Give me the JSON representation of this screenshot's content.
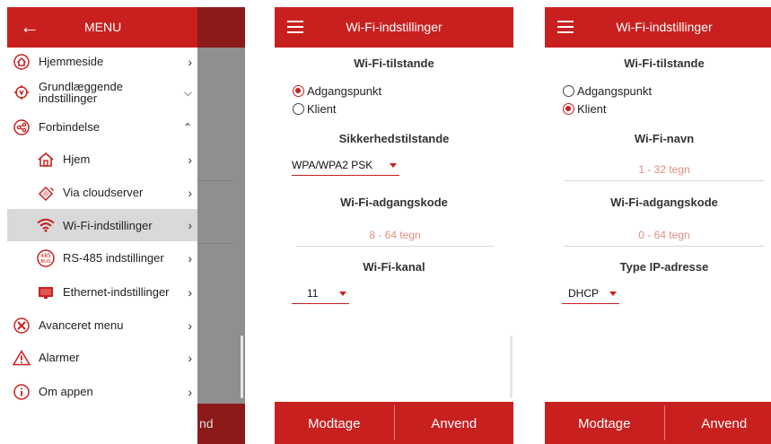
{
  "drawer": {
    "title": "MENU",
    "items": [
      {
        "label": "Hjemmeside"
      },
      {
        "label": "Grundlæggende\nindstillinger"
      },
      {
        "label": "Forbindelse"
      },
      {
        "label": "Hjem"
      },
      {
        "label": "Via cloudserver"
      },
      {
        "label": "Wi-Fi-indstillinger"
      },
      {
        "label": "RS-485 indstillinger"
      },
      {
        "label": "Ethernet-indstillinger"
      },
      {
        "label": "Avanceret menu"
      },
      {
        "label": "Alarmer"
      },
      {
        "label": "Om appen"
      }
    ],
    "behind_footer_text": "nd"
  },
  "screen_ap": {
    "title": "Wi-Fi-indstillinger",
    "mode_heading": "Wi-Fi-tilstande",
    "mode_options": [
      "Adgangspunkt",
      "Klient"
    ],
    "selected_mode": "Adgangspunkt",
    "security_heading": "Sikkerhedstilstande",
    "security_value": "WPA/WPA2 PSK",
    "password_heading": "Wi-Fi-adgangskode",
    "password_placeholder": "8 - 64 tegn",
    "channel_heading": "Wi-Fi-kanal",
    "channel_value": "11",
    "receive_label": "Modtage",
    "apply_label": "Anvend"
  },
  "screen_client": {
    "title": "Wi-Fi-indstillinger",
    "mode_heading": "Wi-Fi-tilstande",
    "mode_options": [
      "Adgangspunkt",
      "Klient"
    ],
    "selected_mode": "Klient",
    "ssid_heading": "Wi-Fi-navn",
    "ssid_placeholder": "1 - 32 tegn",
    "password_heading": "Wi-Fi-adgangskode",
    "password_placeholder": "0 - 64 tegn",
    "ip_heading": "Type IP-adresse",
    "ip_value": "DHCP",
    "receive_label": "Modtage",
    "apply_label": "Anvend"
  },
  "colors": {
    "accent": "#c8201f",
    "active_row": "#d9d9d9",
    "placeholder": "#e08f80"
  }
}
